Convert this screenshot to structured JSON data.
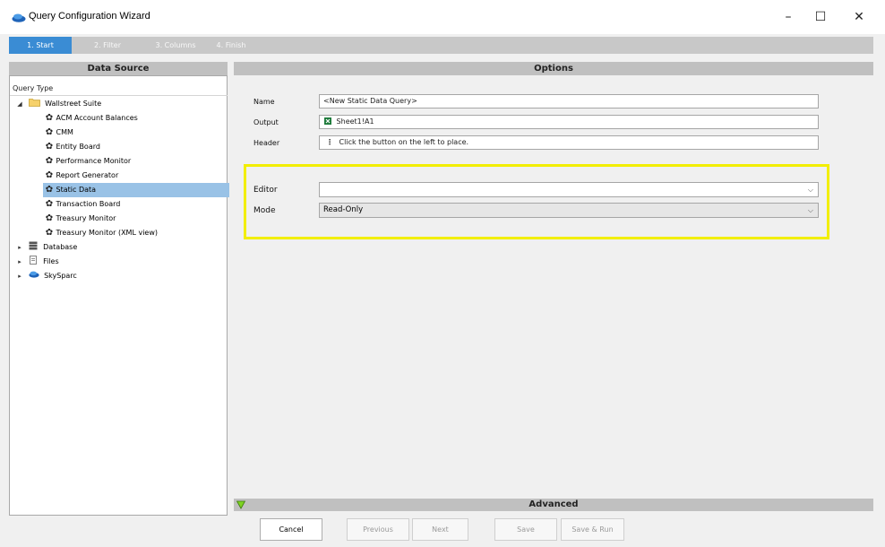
{
  "window": {
    "title": "Query Configuration Wizard",
    "minimize": "–",
    "maximize": "☐",
    "close": "✕"
  },
  "steps": [
    {
      "label": "1. Start",
      "active": true
    },
    {
      "label": "2. Filter",
      "active": false
    },
    {
      "label": "3. Columns",
      "active": false
    },
    {
      "label": "4. Finish",
      "active": false
    }
  ],
  "data_source": {
    "header": "Data Source",
    "query_type_label": "Query Type",
    "tree": {
      "wallstreet": "Wallstreet Suite",
      "children": [
        "ACM Account Balances",
        "CMM",
        "Entity Board",
        "Performance Monitor",
        "Report Generator",
        "Static Data",
        "Transaction Board",
        "Treasury Monitor",
        "Treasury Monitor (XML view)"
      ],
      "selected": "Static Data",
      "database": "Database",
      "files": "Files",
      "skysparc": "SkySparc"
    }
  },
  "options": {
    "header": "Options",
    "name_label": "Name",
    "name_value": "<New Static Data Query>",
    "output_label": "Output",
    "output_value": "Sheet1!A1",
    "header_label": "Header",
    "header_value": "Click the button on the left to place.",
    "editor_label": "Editor",
    "editor_value": "",
    "mode_label": "Mode",
    "mode_value": "Read-Only"
  },
  "advanced": {
    "label": "Advanced"
  },
  "buttons": {
    "cancel": "Cancel",
    "previous": "Previous",
    "next": "Next",
    "save": "Save",
    "save_run": "Save & Run"
  },
  "colors": {
    "accent": "#3a8cd4",
    "selection": "#99c2e6",
    "highlight": "#f2ee00",
    "excel_green": "#1d7a3a"
  },
  "icons": {
    "app": "skysparc-logo-icon",
    "folder": "folder-icon",
    "gear": "gear-icon",
    "database": "database-icon",
    "files": "file-icon",
    "excel": "excel-icon",
    "advanced": "expand-triangle-icon"
  }
}
